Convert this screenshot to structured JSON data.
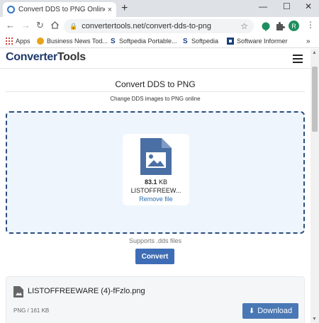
{
  "browser": {
    "tab_title": "Convert DDS to PNG Online - Co",
    "tab_close": "×",
    "new_tab": "+",
    "minimize": "—",
    "maximize": "☐",
    "close": "✕",
    "url": "convertertools.net/convert-dds-to-png",
    "profile_initial": "R"
  },
  "bookmarks": [
    {
      "label": "Apps",
      "icon": "apps-grid-icon"
    },
    {
      "label": "Business News Tod...",
      "icon": "business-news-icon"
    },
    {
      "label": "Softpedia Portable...",
      "icon": "softpedia-icon"
    },
    {
      "label": "Softpedia",
      "icon": "softpedia-icon"
    },
    {
      "label": "Software Informer",
      "icon": "software-informer-icon"
    }
  ],
  "bookmarks_more": "»",
  "site": {
    "logo_part1": "Converter",
    "logo_part2": "Tools",
    "heading": "Convert DDS to PNG",
    "subheading": "Change DDS images to PNG online"
  },
  "upload": {
    "file_size_value": "83.1",
    "file_size_unit": "KB",
    "file_name": "LISTOFFREEW...",
    "remove_label": "Remove file",
    "supports_text": "Supports .dds files",
    "convert_label": "Convert"
  },
  "result": {
    "file_name": "LISTOFFREEWARE (4)-fFzlo.png",
    "meta": "PNG / 161 KB",
    "download_label": "Download"
  },
  "colors": {
    "accent": "#3e6db5",
    "dropzone_border": "#2c4d7d",
    "dropzone_bg": "#eef5fd",
    "link": "#2b6cb0",
    "profile": "#1e8e5e"
  }
}
